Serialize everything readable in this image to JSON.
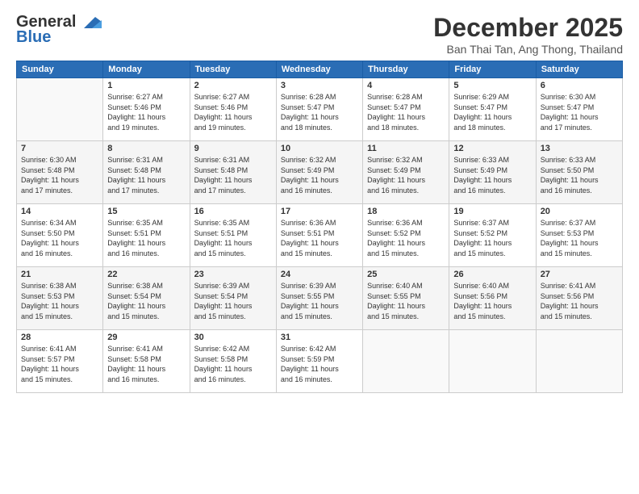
{
  "header": {
    "logo_line1": "General",
    "logo_line2": "Blue",
    "month": "December 2025",
    "location": "Ban Thai Tan, Ang Thong, Thailand"
  },
  "days_of_week": [
    "Sunday",
    "Monday",
    "Tuesday",
    "Wednesday",
    "Thursday",
    "Friday",
    "Saturday"
  ],
  "weeks": [
    [
      {
        "day": "",
        "info": ""
      },
      {
        "day": "1",
        "info": "Sunrise: 6:27 AM\nSunset: 5:46 PM\nDaylight: 11 hours\nand 19 minutes."
      },
      {
        "day": "2",
        "info": "Sunrise: 6:27 AM\nSunset: 5:46 PM\nDaylight: 11 hours\nand 19 minutes."
      },
      {
        "day": "3",
        "info": "Sunrise: 6:28 AM\nSunset: 5:47 PM\nDaylight: 11 hours\nand 18 minutes."
      },
      {
        "day": "4",
        "info": "Sunrise: 6:28 AM\nSunset: 5:47 PM\nDaylight: 11 hours\nand 18 minutes."
      },
      {
        "day": "5",
        "info": "Sunrise: 6:29 AM\nSunset: 5:47 PM\nDaylight: 11 hours\nand 18 minutes."
      },
      {
        "day": "6",
        "info": "Sunrise: 6:30 AM\nSunset: 5:47 PM\nDaylight: 11 hours\nand 17 minutes."
      }
    ],
    [
      {
        "day": "7",
        "info": "Sunrise: 6:30 AM\nSunset: 5:48 PM\nDaylight: 11 hours\nand 17 minutes."
      },
      {
        "day": "8",
        "info": "Sunrise: 6:31 AM\nSunset: 5:48 PM\nDaylight: 11 hours\nand 17 minutes."
      },
      {
        "day": "9",
        "info": "Sunrise: 6:31 AM\nSunset: 5:48 PM\nDaylight: 11 hours\nand 17 minutes."
      },
      {
        "day": "10",
        "info": "Sunrise: 6:32 AM\nSunset: 5:49 PM\nDaylight: 11 hours\nand 16 minutes."
      },
      {
        "day": "11",
        "info": "Sunrise: 6:32 AM\nSunset: 5:49 PM\nDaylight: 11 hours\nand 16 minutes."
      },
      {
        "day": "12",
        "info": "Sunrise: 6:33 AM\nSunset: 5:49 PM\nDaylight: 11 hours\nand 16 minutes."
      },
      {
        "day": "13",
        "info": "Sunrise: 6:33 AM\nSunset: 5:50 PM\nDaylight: 11 hours\nand 16 minutes."
      }
    ],
    [
      {
        "day": "14",
        "info": "Sunrise: 6:34 AM\nSunset: 5:50 PM\nDaylight: 11 hours\nand 16 minutes."
      },
      {
        "day": "15",
        "info": "Sunrise: 6:35 AM\nSunset: 5:51 PM\nDaylight: 11 hours\nand 16 minutes."
      },
      {
        "day": "16",
        "info": "Sunrise: 6:35 AM\nSunset: 5:51 PM\nDaylight: 11 hours\nand 15 minutes."
      },
      {
        "day": "17",
        "info": "Sunrise: 6:36 AM\nSunset: 5:51 PM\nDaylight: 11 hours\nand 15 minutes."
      },
      {
        "day": "18",
        "info": "Sunrise: 6:36 AM\nSunset: 5:52 PM\nDaylight: 11 hours\nand 15 minutes."
      },
      {
        "day": "19",
        "info": "Sunrise: 6:37 AM\nSunset: 5:52 PM\nDaylight: 11 hours\nand 15 minutes."
      },
      {
        "day": "20",
        "info": "Sunrise: 6:37 AM\nSunset: 5:53 PM\nDaylight: 11 hours\nand 15 minutes."
      }
    ],
    [
      {
        "day": "21",
        "info": "Sunrise: 6:38 AM\nSunset: 5:53 PM\nDaylight: 11 hours\nand 15 minutes."
      },
      {
        "day": "22",
        "info": "Sunrise: 6:38 AM\nSunset: 5:54 PM\nDaylight: 11 hours\nand 15 minutes."
      },
      {
        "day": "23",
        "info": "Sunrise: 6:39 AM\nSunset: 5:54 PM\nDaylight: 11 hours\nand 15 minutes."
      },
      {
        "day": "24",
        "info": "Sunrise: 6:39 AM\nSunset: 5:55 PM\nDaylight: 11 hours\nand 15 minutes."
      },
      {
        "day": "25",
        "info": "Sunrise: 6:40 AM\nSunset: 5:55 PM\nDaylight: 11 hours\nand 15 minutes."
      },
      {
        "day": "26",
        "info": "Sunrise: 6:40 AM\nSunset: 5:56 PM\nDaylight: 11 hours\nand 15 minutes."
      },
      {
        "day": "27",
        "info": "Sunrise: 6:41 AM\nSunset: 5:56 PM\nDaylight: 11 hours\nand 15 minutes."
      }
    ],
    [
      {
        "day": "28",
        "info": "Sunrise: 6:41 AM\nSunset: 5:57 PM\nDaylight: 11 hours\nand 15 minutes."
      },
      {
        "day": "29",
        "info": "Sunrise: 6:41 AM\nSunset: 5:58 PM\nDaylight: 11 hours\nand 16 minutes."
      },
      {
        "day": "30",
        "info": "Sunrise: 6:42 AM\nSunset: 5:58 PM\nDaylight: 11 hours\nand 16 minutes."
      },
      {
        "day": "31",
        "info": "Sunrise: 6:42 AM\nSunset: 5:59 PM\nDaylight: 11 hours\nand 16 minutes."
      },
      {
        "day": "",
        "info": ""
      },
      {
        "day": "",
        "info": ""
      },
      {
        "day": "",
        "info": ""
      }
    ]
  ]
}
